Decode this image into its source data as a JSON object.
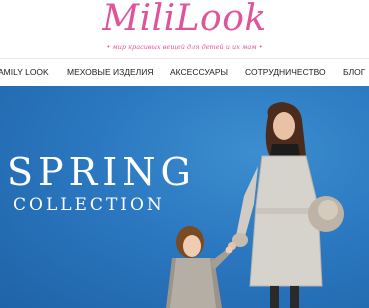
{
  "header": {
    "logo": "MiliLook",
    "tagline": "• мир красивых вещей для детей и их мам •"
  },
  "nav": {
    "items": [
      "AMILY LOOK",
      "МЕХОВЫЕ ИЗДЕЛИЯ",
      "АКСЕССУАРЫ",
      "СОТРУДНИЧЕСТВО",
      "БЛОГ"
    ]
  },
  "hero": {
    "title": "SPRING",
    "subtitle": "COLLECTION"
  },
  "colors": {
    "brand_pink": "#e0559a",
    "hero_blue": "#2b78c0",
    "nav_text": "#222222"
  }
}
